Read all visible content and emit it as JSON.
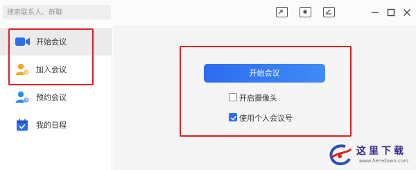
{
  "search": {
    "placeholder": "搜索联系人、群聊"
  },
  "toolbar": {
    "icons": [
      "share-screen-icon",
      "screen-record-icon",
      "whiteboard-icon"
    ]
  },
  "window_controls": [
    "minimize-icon",
    "maximize-icon",
    "close-icon"
  ],
  "sidebar": {
    "items": [
      {
        "label": "开始会议",
        "icon": "video-camera-icon",
        "active": true
      },
      {
        "label": "加入会议",
        "icon": "user-join-icon",
        "active": false
      },
      {
        "label": "预约会议",
        "icon": "user-schedule-icon",
        "active": false
      },
      {
        "label": "我的日程",
        "icon": "calendar-icon",
        "active": false
      }
    ]
  },
  "main": {
    "start_button": "开始会议",
    "options": [
      {
        "label": "开启摄像头",
        "checked": false
      },
      {
        "label": "使用个人会议号",
        "checked": true
      }
    ]
  },
  "watermark": {
    "title": "这里下载",
    "url": "www.heredown.com"
  },
  "colors": {
    "accent": "#2d6cf0",
    "highlight_box": "#e02020",
    "icon_orange": "#f5a623"
  }
}
